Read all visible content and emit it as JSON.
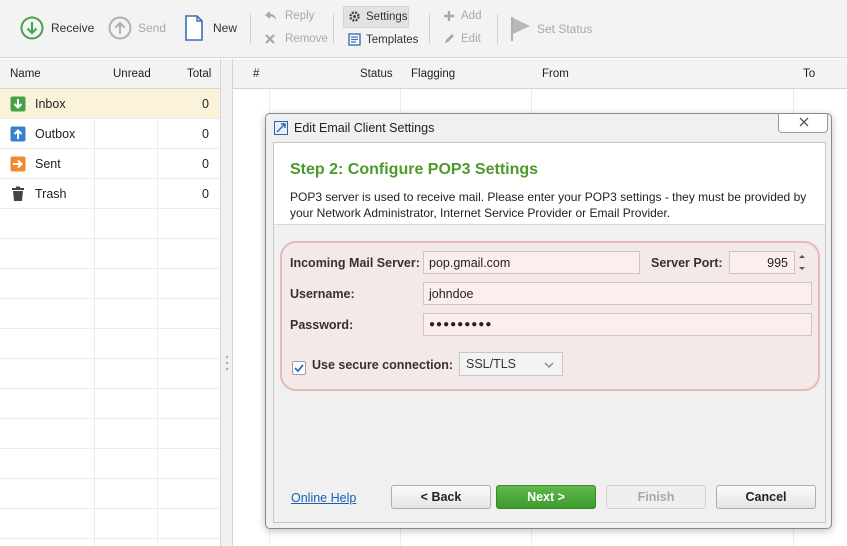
{
  "toolbar": {
    "receive": "Receive",
    "send": "Send",
    "new": "New",
    "reply": "Reply",
    "remove": "Remove",
    "settings": "Settings",
    "templates": "Templates",
    "add": "Add",
    "edit": "Edit",
    "set_status": "Set Status"
  },
  "folders": {
    "headers": {
      "name": "Name",
      "unread": "Unread",
      "total": "Total"
    },
    "items": [
      {
        "name": "Inbox",
        "total": "0",
        "icon": "inbox-icon",
        "color": "#4aa04a"
      },
      {
        "name": "Outbox",
        "total": "0",
        "icon": "outbox-icon",
        "color": "#3c7fd0"
      },
      {
        "name": "Sent",
        "total": "0",
        "icon": "sent-icon",
        "color": "#f08a2c"
      },
      {
        "name": "Trash",
        "total": "0",
        "icon": "trash-icon",
        "color": "#444444"
      }
    ]
  },
  "messages": {
    "headers": {
      "num": "#",
      "status": "Status",
      "flagging": "Flagging",
      "from": "From",
      "to": "To"
    }
  },
  "dialog": {
    "title": "Edit Email Client Settings",
    "step_title": "Step 2: Configure POP3 Settings",
    "description": "POP3 server is used to receive mail. Please enter your POP3 settings - they must be provided by your Network Administrator, Internet Service Provider or Email Provider.",
    "incoming_label": "Incoming Mail Server:",
    "incoming_value": "pop.gmail.com",
    "port_label": "Server Port:",
    "port_value": "995",
    "username_label": "Username:",
    "username_value": "johndoe",
    "password_label": "Password:",
    "password_value": "●●●●●●●●●",
    "secure_label": "Use secure connection:",
    "secure_checked": true,
    "secure_value": "SSL/TLS",
    "online_help": "Online Help",
    "back": "< Back",
    "next": "Next >",
    "finish": "Finish",
    "cancel": "Cancel"
  },
  "colors": {
    "accent_green": "#4c9a2a",
    "selected_row": "#faf3d9"
  }
}
